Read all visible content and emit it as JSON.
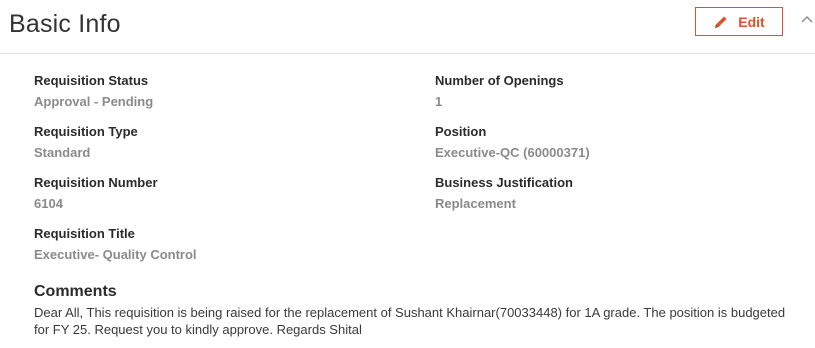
{
  "section": {
    "title": "Basic Info",
    "edit_label": "Edit"
  },
  "fields": {
    "requisition_status": {
      "label": "Requisition Status",
      "value": "Approval - Pending"
    },
    "number_of_openings": {
      "label": "Number of Openings",
      "value": "1"
    },
    "requisition_type": {
      "label": "Requisition Type",
      "value": "Standard"
    },
    "position": {
      "label": "Position",
      "value": "Executive-QC (60000371)"
    },
    "requisition_number": {
      "label": "Requisition Number",
      "value": "6104"
    },
    "business_justification": {
      "label": "Business Justification",
      "value": "Replacement"
    },
    "requisition_title": {
      "label": "Requisition Title",
      "value": "Executive- Quality Control"
    }
  },
  "comments": {
    "label": "Comments",
    "text": "Dear All,  This requisition is being raised for the replacement of Sushant Khairnar(70033448) for 1A grade. The position is budgeted for FY 25. Request you to kindly approve. Regards Shital"
  },
  "colors": {
    "accent": "#d9542b",
    "label": "#2b2b2b",
    "value": "#8a8a8a"
  },
  "icons": {
    "edit": "pencil-icon",
    "collapse": "chevron-up-icon"
  }
}
